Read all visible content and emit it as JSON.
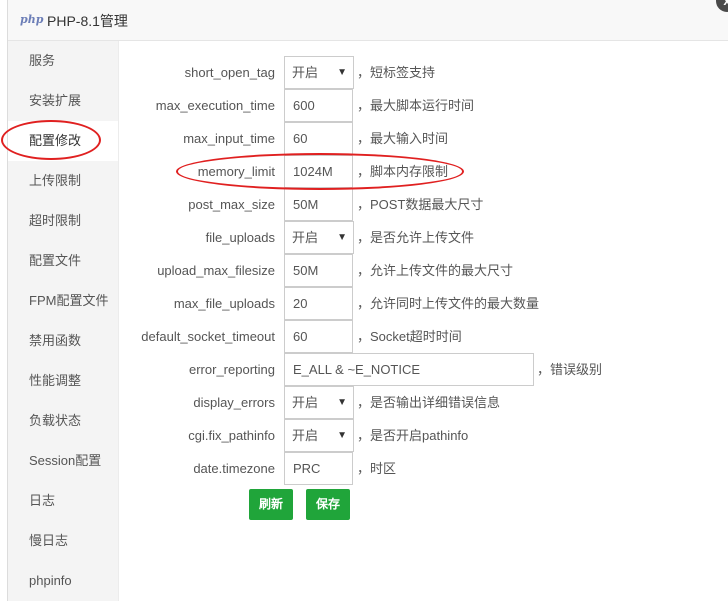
{
  "window": {
    "logo_text": "php",
    "title": "PHP-8.1管理",
    "close_label": "x"
  },
  "sidebar": {
    "items": [
      {
        "label": "服务"
      },
      {
        "label": "安装扩展"
      },
      {
        "label": "配置修改"
      },
      {
        "label": "上传限制"
      },
      {
        "label": "超时限制"
      },
      {
        "label": "配置文件"
      },
      {
        "label": "FPM配置文件"
      },
      {
        "label": "禁用函数"
      },
      {
        "label": "性能调整"
      },
      {
        "label": "负载状态"
      },
      {
        "label": "Session配置"
      },
      {
        "label": "日志"
      },
      {
        "label": "慢日志"
      },
      {
        "label": "phpinfo"
      }
    ],
    "active_index": 2
  },
  "config": {
    "rows": [
      {
        "name": "short_open_tag",
        "value": "开启",
        "kind": "select",
        "desc": "，短标签支持"
      },
      {
        "name": "max_execution_time",
        "value": "600",
        "kind": "text",
        "desc": "，最大脚本运行时间"
      },
      {
        "name": "max_input_time",
        "value": "60",
        "kind": "text",
        "desc": "，最大输入时间"
      },
      {
        "name": "memory_limit",
        "value": "1024M",
        "kind": "text",
        "desc": "，脚本内存限制"
      },
      {
        "name": "post_max_size",
        "value": "50M",
        "kind": "text",
        "desc": "，POST数据最大尺寸"
      },
      {
        "name": "file_uploads",
        "value": "开启",
        "kind": "select",
        "desc": "，是否允许上传文件"
      },
      {
        "name": "upload_max_filesize",
        "value": "50M",
        "kind": "text",
        "desc": "，允许上传文件的最大尺寸"
      },
      {
        "name": "max_file_uploads",
        "value": "20",
        "kind": "text",
        "desc": "，允许同时上传文件的最大数量"
      },
      {
        "name": "default_socket_timeout",
        "value": "60",
        "kind": "text",
        "desc": "，Socket超时时间"
      },
      {
        "name": "error_reporting",
        "value": "E_ALL & ~E_NOTICE",
        "kind": "wide",
        "desc": "，错误级别"
      },
      {
        "name": "display_errors",
        "value": "开启",
        "kind": "select",
        "desc": "，是否输出详细错误信息"
      },
      {
        "name": "cgi.fix_pathinfo",
        "value": "开启",
        "kind": "select",
        "desc": "，是否开启pathinfo"
      },
      {
        "name": "date.timezone",
        "value": "PRC",
        "kind": "text",
        "desc": "，时区"
      }
    ]
  },
  "buttons": {
    "refresh_label": "刷新",
    "save_label": "保存"
  },
  "colors": {
    "accent_green": "#20a53a",
    "annotation_red": "#e02020"
  },
  "icons": {
    "select_arrow": "chevron-down-icon",
    "close": "close-icon"
  }
}
